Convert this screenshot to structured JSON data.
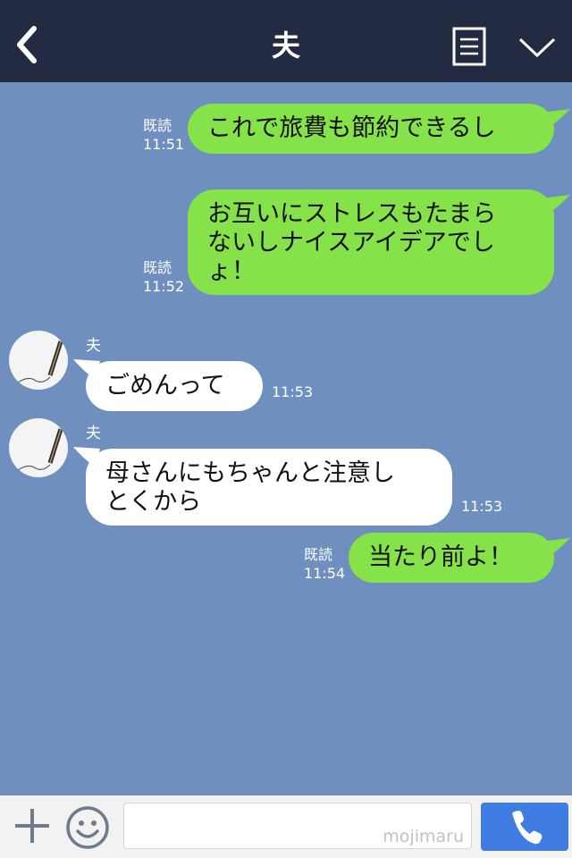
{
  "header": {
    "title": "夫"
  },
  "messages": [
    {
      "from": "me",
      "text_lines": [
        "これで旅費も節約できるし"
      ],
      "read": "既読",
      "time": "11:51"
    },
    {
      "from": "me",
      "text_lines": [
        "お互いにストレスもたまら",
        "ないしナイスアイデアでし",
        "ょ！"
      ],
      "read": "既読",
      "time": "11:52"
    },
    {
      "from": "them",
      "sender": "夫",
      "text_lines": [
        "ごめんって"
      ],
      "time": "11:53"
    },
    {
      "from": "them",
      "sender": "夫",
      "text_lines": [
        "母さんにもちゃんと注意し",
        "とくから"
      ],
      "time": "11:53"
    },
    {
      "from": "me",
      "text_lines": [
        "当たり前よ！"
      ],
      "read": "既読",
      "time": "11:54"
    }
  ],
  "footer": {
    "input_value": "",
    "watermark": "mojimaru"
  },
  "icons": {
    "back": "chevron-left-icon",
    "menu": "document-list-icon",
    "collapse": "chevron-down-icon",
    "add": "plus-icon",
    "emoji": "smiley-icon",
    "call": "phone-icon"
  },
  "colors": {
    "header_bg": "#232b43",
    "chat_bg": "#6f8fbe",
    "my_bubble": "#85e249",
    "their_bubble": "#ffffff",
    "call_button": "#3f7de3"
  }
}
